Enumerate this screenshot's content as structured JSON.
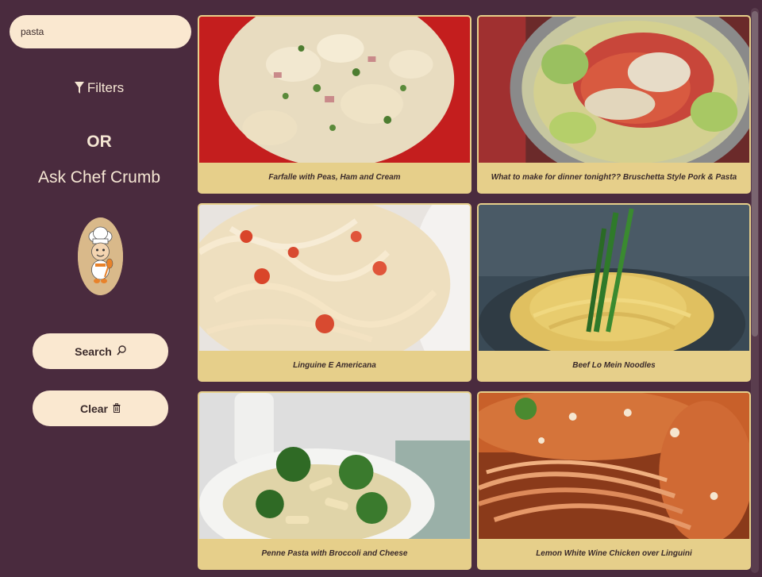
{
  "search": {
    "value": "pasta",
    "placeholder": ""
  },
  "sidebar": {
    "filters_label": "Filters",
    "or_label": "OR",
    "ask_label": "Ask Chef Crumb",
    "search_button": "Search",
    "clear_button": "Clear"
  },
  "icons": {
    "filter": "funnel-icon",
    "search": "magnifier-icon",
    "clear": "trash-icon",
    "chef": "chef-avatar-icon"
  },
  "colors": {
    "background": "#4a2b3e",
    "cream": "#fae8d0",
    "card": "#e6cf8a",
    "text_light": "#f5e6d3"
  },
  "recipes": [
    {
      "title": "Farfalle with Peas, Ham and Cream"
    },
    {
      "title": "What to make for dinner tonight?? Bruschetta Style Pork & Pasta"
    },
    {
      "title": "Linguine E Americana"
    },
    {
      "title": "Beef Lo Mein Noodles"
    },
    {
      "title": "Penne Pasta with Broccoli and Cheese"
    },
    {
      "title": "Lemon White Wine Chicken over Linguini"
    }
  ]
}
